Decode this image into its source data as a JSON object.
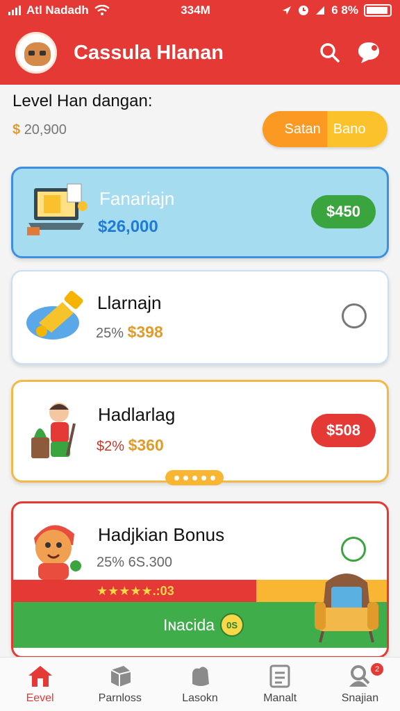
{
  "status_bar": {
    "carrier": "Atl Nadadh",
    "time": "334M",
    "battery_text": "6 8%"
  },
  "app_bar": {
    "title": "Cassula Hlanan"
  },
  "summary": {
    "title": "Level Han dangan:",
    "currency": "$",
    "amount": "20,900",
    "button_left": "Satan",
    "button_right": "Bano"
  },
  "cards": [
    {
      "title": "Fanariajn",
      "amount": "$26,000",
      "price": "$450",
      "price_color": "#3aa43f"
    },
    {
      "title": "Llarnajn",
      "discount": "25%",
      "amount": "$398"
    },
    {
      "title": "Hadlarlag",
      "discount": "$2%",
      "amount": "$360",
      "price": "$508",
      "price_color": "#e53935"
    },
    {
      "title": "Hadjkian Bonus",
      "discount": "25%",
      "amount": "6S.300"
    }
  ],
  "promo": {
    "rating_text": "★★★★★.:03",
    "banner_text": "Iɴacida",
    "badge_text": "0S"
  },
  "bottom_nav": [
    {
      "label": "Eevel",
      "icon": "home-icon",
      "active": true
    },
    {
      "label": "Parnloss",
      "icon": "box-icon"
    },
    {
      "label": "Lasokn",
      "icon": "bag-icon"
    },
    {
      "label": "Manalt",
      "icon": "document-icon"
    },
    {
      "label": "Snajian",
      "icon": "profile-icon",
      "badge": "2"
    }
  ],
  "colors": {
    "primary": "#e53935",
    "accent_orange": "#fb9a22",
    "success": "#3aa43f",
    "info": "#1f7bd8"
  }
}
